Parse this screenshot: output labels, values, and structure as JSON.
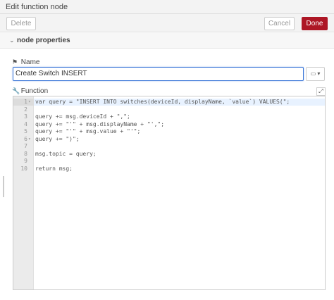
{
  "header": {
    "title": "Edit function node"
  },
  "toolbar": {
    "delete_label": "Delete",
    "cancel_label": "Cancel",
    "done_label": "Done"
  },
  "section": {
    "title": "node properties",
    "chevron": "⌄"
  },
  "name_field": {
    "label": "Name",
    "value": "Create Switch INSERT",
    "icon": "tag-icon"
  },
  "function_field": {
    "label": "Function",
    "icon": "wrench-icon"
  },
  "icon_select": {
    "glyph": "▭ ▾"
  },
  "expand": {
    "glyph": "⤢"
  },
  "colors": {
    "done_button": "#ad1625",
    "accent": "#3875d7"
  },
  "editor": {
    "lines": [
      {
        "n": "1",
        "fold": "▾",
        "code": "var query = \"INSERT INTO switches(deviceId, displayName, `value`) VALUES(\";"
      },
      {
        "n": "2",
        "fold": "",
        "code": ""
      },
      {
        "n": "3",
        "fold": "",
        "code": "query += msg.deviceId + \",\";"
      },
      {
        "n": "4",
        "fold": "",
        "code": "query += \"'\" + msg.displayName + \"',\";"
      },
      {
        "n": "5",
        "fold": "",
        "code": "query += \"'\" + msg.value + \"'\";"
      },
      {
        "n": "6",
        "fold": "▾",
        "code": "query += \")\";"
      },
      {
        "n": "7",
        "fold": "",
        "code": ""
      },
      {
        "n": "8",
        "fold": "",
        "code": "msg.topic = query;"
      },
      {
        "n": "9",
        "fold": "",
        "code": ""
      },
      {
        "n": "10",
        "fold": "",
        "code": "return msg;"
      }
    ]
  }
}
